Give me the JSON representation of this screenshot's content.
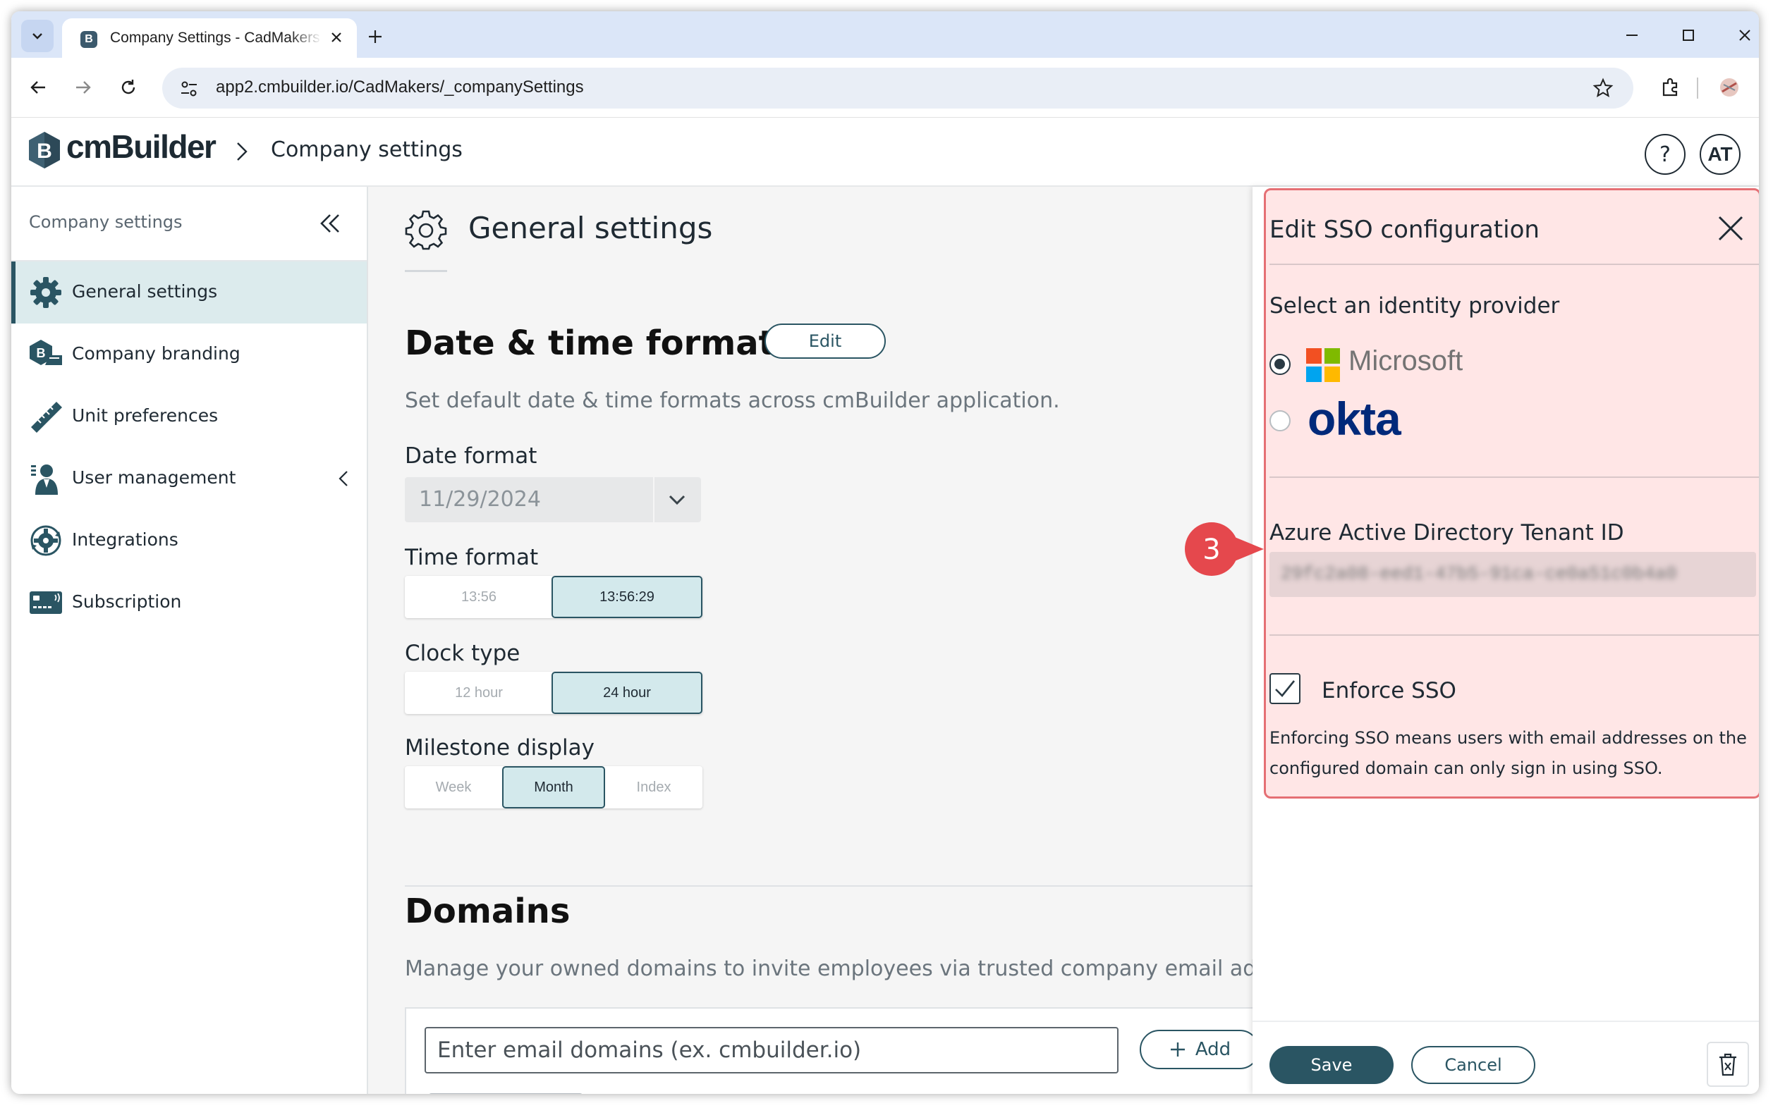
{
  "browser": {
    "tab_title": "Company Settings - CadMakers",
    "url": "app2.cmbuilder.io/CadMakers/_companySettings"
  },
  "app": {
    "logo_text": "cmBuilder",
    "breadcrumb": "Company settings",
    "help_label": "?",
    "user_initials": "AT"
  },
  "sidebar": {
    "title": "Company settings",
    "items": [
      {
        "label": "General settings",
        "icon": "gear-icon",
        "active": true
      },
      {
        "label": "Company branding",
        "icon": "branding-icon"
      },
      {
        "label": "Unit preferences",
        "icon": "ruler-icon"
      },
      {
        "label": "User management",
        "icon": "user-icon"
      },
      {
        "label": "Integrations",
        "icon": "integrations-icon"
      },
      {
        "label": "Subscription",
        "icon": "subscription-icon"
      }
    ]
  },
  "main": {
    "page_title": "General settings",
    "datetime": {
      "heading": "Date & time formats",
      "edit_label": "Edit",
      "description": "Set default date & time formats across cmBuilder application.",
      "date_format_label": "Date format",
      "date_format_value": "11/29/2024",
      "time_format_label": "Time format",
      "time_options": [
        "13:56",
        "13:56:29"
      ],
      "time_selected": "13:56:29",
      "clock_type_label": "Clock type",
      "clock_options": [
        "12 hour",
        "24 hour"
      ],
      "clock_selected": "24 hour",
      "milestone_label": "Milestone display",
      "milestone_options": [
        "Week",
        "Month",
        "Index"
      ],
      "milestone_selected": "Month"
    },
    "domains": {
      "heading": "Domains",
      "description": "Manage your owned domains to invite employees via trusted company email addresses.",
      "input_placeholder": "Enter email domains (ex. cmbuilder.io)",
      "add_label": "Add"
    }
  },
  "sso_panel": {
    "title": "Edit SSO configuration",
    "provider_label": "Select an identity provider",
    "providers": [
      {
        "name": "Microsoft",
        "selected": true
      },
      {
        "name": "okta",
        "selected": false
      }
    ],
    "tenant_label": "Azure Active Directory Tenant ID",
    "tenant_value": "29fc2a08-eed1-47b5-91ca-ce0a51c0b4a0",
    "enforce_label": "Enforce SSO",
    "enforce_checked": true,
    "enforce_description": "Enforcing SSO means users with email addresses on the configured domain can only sign in using SSO.",
    "save_label": "Save",
    "cancel_label": "Cancel"
  },
  "annotation": {
    "callout_number": "3",
    "color": "#e5484d"
  },
  "colors": {
    "primary": "#2a5563",
    "selected_bg": "#d3e9ec",
    "highlight": "#e56f74"
  }
}
